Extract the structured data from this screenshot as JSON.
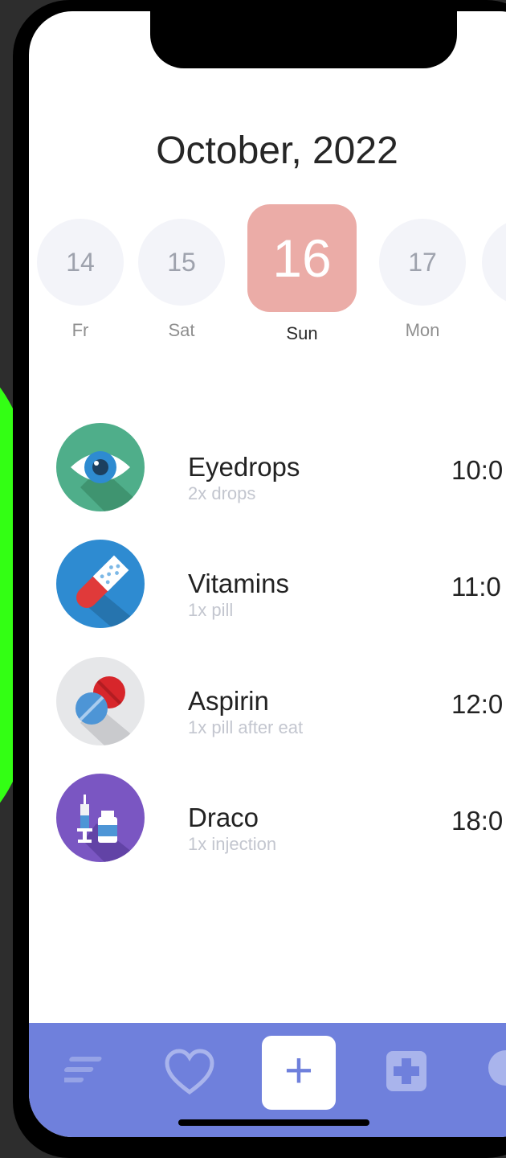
{
  "header": {
    "month_title": "October, 2022"
  },
  "calendar": {
    "days": [
      {
        "number": "14",
        "weekday": "Fr"
      },
      {
        "number": "15",
        "weekday": "Sat"
      },
      {
        "number": "16",
        "weekday": "Sun",
        "selected": true
      },
      {
        "number": "17",
        "weekday": "Mon"
      }
    ],
    "selected_color": "#ebaca7"
  },
  "medications": [
    {
      "name": "Eyedrops",
      "dose": "2x drops",
      "time": "10:0",
      "icon": "eye-icon",
      "color": "#4fae8a"
    },
    {
      "name": "Vitamins",
      "dose": "1x pill",
      "time": "11:0",
      "icon": "pill-capsule-icon",
      "color": "#2e8bd1"
    },
    {
      "name": "Aspirin",
      "dose": "1x pill after eat",
      "time": "12:0",
      "icon": "tablets-icon",
      "color": "#e6e7e9"
    },
    {
      "name": "Draco",
      "dose": "1x injection",
      "time": "18:0",
      "icon": "syringe-icon",
      "color": "#7a56c2"
    }
  ],
  "bottom_nav": {
    "add_label": "+",
    "bar_color": "#6f80dc",
    "items": [
      "menu-icon",
      "heart-icon",
      "add-button",
      "first-aid-icon",
      "pie-chart-icon"
    ]
  }
}
